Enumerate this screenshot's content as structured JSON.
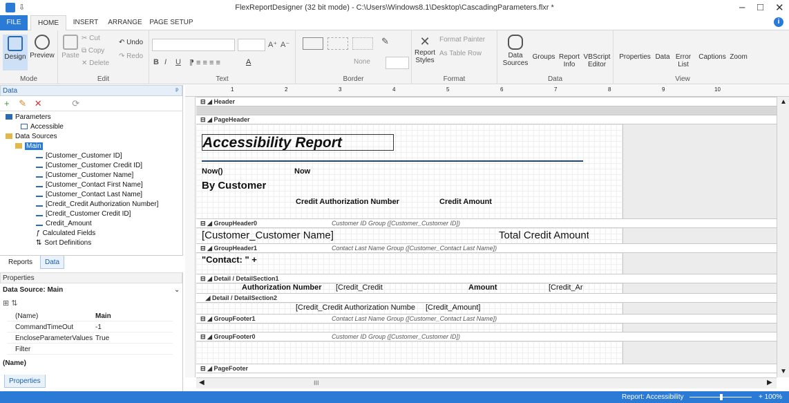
{
  "window": {
    "title": "FlexReportDesigner (32 bit mode) - C:\\Users\\Windows8.1\\Desktop\\CascadingParameters.flxr *",
    "minimize": "–",
    "maximize": "□",
    "close": "✕"
  },
  "tabs": [
    "FILE",
    "HOME",
    "INSERT",
    "ARRANGE",
    "PAGE SETUP"
  ],
  "ribbon": {
    "mode": {
      "label": "Mode",
      "design": "Design",
      "preview": "Preview"
    },
    "edit": {
      "label": "Edit",
      "paste": "Paste",
      "cut": "Cut",
      "copy": "Copy",
      "delete": "Delete",
      "undo": "Undo",
      "redo": "Redo"
    },
    "text": {
      "label": "Text",
      "bold": "B",
      "italic": "I",
      "underline": "U",
      "grow": "A⁺",
      "shrink": "A⁻",
      "color": "A"
    },
    "border": {
      "label": "Border",
      "none": "None"
    },
    "format": {
      "label": "Format",
      "painter": "Format Painter",
      "as_table": "As Table Row",
      "report_styles": "Report Styles"
    },
    "data": {
      "label": "Data",
      "sources": "Data Sources",
      "groups": "Groups",
      "report_info": "Report Info",
      "vbscript": "VBScript Editor"
    },
    "view": {
      "label": "View",
      "properties": "Properties",
      "data": "Data",
      "error_list": "Error List",
      "captions": "Captions",
      "zoom": "Zoom"
    }
  },
  "datapanel": {
    "title": "Data",
    "pin": "ᵖ",
    "tree": [
      {
        "label": "Parameters",
        "level": 0
      },
      {
        "label": "Accessible",
        "level": 1
      },
      {
        "label": "Data Sources",
        "level": 0
      },
      {
        "label": "Main",
        "level": 1
      },
      {
        "label": "[Customer_Customer ID]",
        "level": 2
      },
      {
        "label": "[Customer_Customer Credit ID]",
        "level": 2
      },
      {
        "label": "[Customer_Customer Name]",
        "level": 2
      },
      {
        "label": "[Customer_Contact First Name]",
        "level": 2
      },
      {
        "label": "[Customer_Contact Last Name]",
        "level": 2
      },
      {
        "label": "[Credit_Credit Authorization Number]",
        "level": 2
      },
      {
        "label": "[Credit_Customer Credit ID]",
        "level": 2
      },
      {
        "label": "Credit_Amount",
        "level": 2
      },
      {
        "label": "Calculated Fields",
        "level": 2
      },
      {
        "label": "Sort Definitions",
        "level": 2
      }
    ],
    "tab_reports": "Reports",
    "tab_data": "Data"
  },
  "properties": {
    "title": "Properties",
    "source": "Data Source: Main",
    "rows": [
      {
        "k": "(Name)",
        "v": "Main"
      },
      {
        "k": "CommandTimeOut",
        "v": "-1"
      },
      {
        "k": "EncloseParameterValues",
        "v": "True"
      },
      {
        "k": "Filter",
        "v": ""
      }
    ],
    "desc": "(Name)",
    "tab": "Properties"
  },
  "ruler": [
    "1",
    "2",
    "3",
    "4",
    "5",
    "6",
    "7",
    "8",
    "9",
    "10"
  ],
  "sections": [
    {
      "name": "Header",
      "desc": ""
    },
    {
      "name": "PageHeader",
      "desc": ""
    },
    {
      "name": "GroupHeader0",
      "desc": "Customer ID Group ([Customer_Customer ID])"
    },
    {
      "name": "GroupHeader1",
      "desc": "Contact Last Name Group ([Customer_Contact Last Name])"
    },
    {
      "name": "Detail / DetailSection1",
      "desc": ""
    },
    {
      "name": "Detail / DetailSection2",
      "desc": ""
    },
    {
      "name": "GroupFooter1",
      "desc": "Contact Last Name Group ([Customer_Contact Last Name])"
    },
    {
      "name": "GroupFooter0",
      "desc": "Customer ID Group ([Customer_Customer ID])"
    },
    {
      "name": "PageFooter",
      "desc": ""
    }
  ],
  "fields": {
    "report_title": "Accessibility Report",
    "now1": "Now()",
    "now2": "Now",
    "by_customer": "By Customer",
    "credit_auth": "Credit Authorization Number",
    "credit_amount": "Credit Amount",
    "customer_name": "[Customer_Customer Name]",
    "total_credit": "Total Credit Amount",
    "contact": "\"Contact: \" +",
    "auth_number": "Authorization Number",
    "credit_credit": "[Credit_Credit",
    "amount": "Amount",
    "credit_am": "[Credit_Ar",
    "detail2_auth": "[Credit_Credit Authorization Numbe",
    "detail2_amount": "[Credit_Amount]"
  },
  "hscroll_mark": "III",
  "status": {
    "report": "Report: Accessibility",
    "zoom": "+ 100%"
  }
}
